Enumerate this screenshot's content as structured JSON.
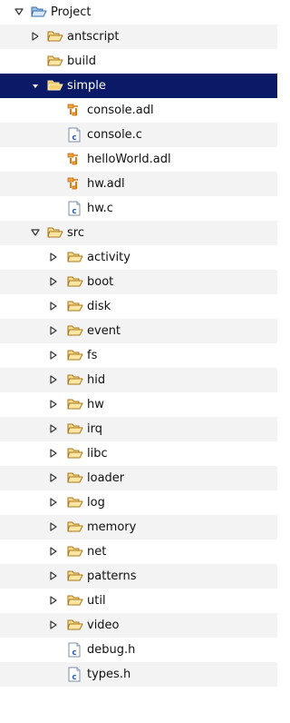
{
  "colors": {
    "selection": "#0b1a66",
    "stripe": "#f3f3f3",
    "folder": "#f3c35a",
    "c_file": "#2d5fb0",
    "adl_file": "#e07a16"
  },
  "tree": {
    "project": {
      "label": "Project",
      "state": "expanded",
      "icon": "project-folder-icon"
    },
    "antscript": {
      "label": "antscript",
      "state": "collapsed",
      "icon": "folder-icon"
    },
    "build": {
      "label": "build",
      "icon": "folder-icon"
    },
    "simple": {
      "label": "simple",
      "state": "expanded",
      "selected": true,
      "icon": "folder-open-icon",
      "children": [
        {
          "label": "console.adl",
          "icon": "adl-file-icon"
        },
        {
          "label": "console.c",
          "icon": "c-file-icon"
        },
        {
          "label": "helloWorld.adl",
          "icon": "adl-file-icon"
        },
        {
          "label": "hw.adl",
          "icon": "adl-file-icon"
        },
        {
          "label": "hw.c",
          "icon": "c-file-icon"
        }
      ]
    },
    "src": {
      "label": "src",
      "state": "expanded",
      "icon": "folder-icon",
      "folders": [
        "activity",
        "boot",
        "disk",
        "event",
        "fs",
        "hid",
        "hw",
        "irq",
        "libc",
        "loader",
        "log",
        "memory",
        "net",
        "patterns",
        "util",
        "video"
      ],
      "files": [
        {
          "label": "debug.h",
          "icon": "c-file-icon"
        },
        {
          "label": "types.h",
          "icon": "c-file-icon"
        }
      ]
    }
  }
}
